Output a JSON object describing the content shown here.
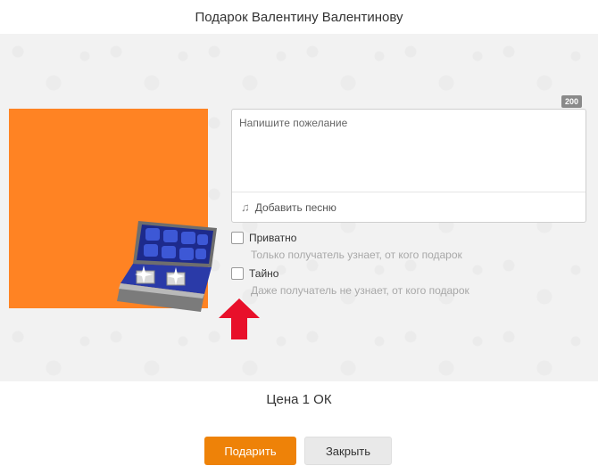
{
  "dialog": {
    "title": "Подарок Валентину Валентинову"
  },
  "gift": {
    "background_color": "#ff8323",
    "image_name": "jewelry-box-with-cufflinks"
  },
  "wish": {
    "placeholder": "Напишите пожелание",
    "counter": "200",
    "add_song_label": "Добавить песню"
  },
  "options": [
    {
      "label": "Приватно",
      "hint": "Только получатель узнает, от кого подарок",
      "checked": false
    },
    {
      "label": "Тайно",
      "hint": "Даже получатель не узнает, от кого подарок",
      "checked": false
    }
  ],
  "price": {
    "label": "Цена 1 ОК"
  },
  "buttons": {
    "gift_label": "Подарить",
    "close_label": "Закрыть"
  },
  "colors": {
    "accent": "#ee8208",
    "arrow": "#e8102a"
  }
}
